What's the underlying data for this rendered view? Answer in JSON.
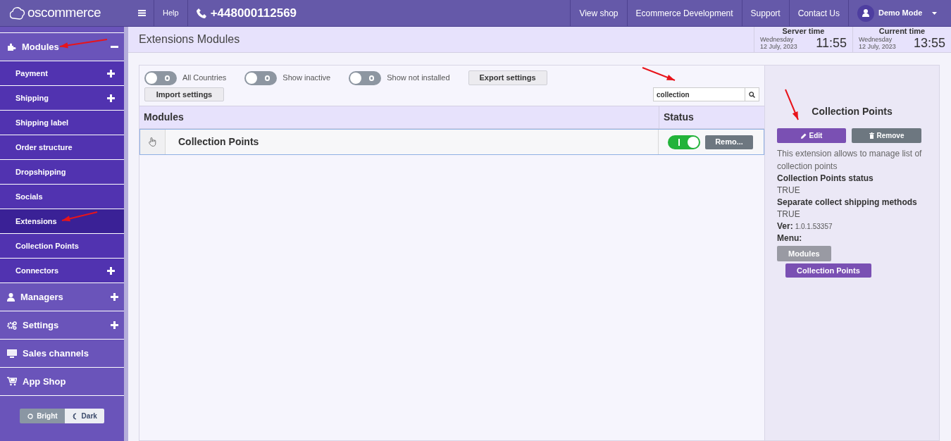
{
  "topbar": {
    "logo": "oscommerce",
    "help": "Help",
    "phone": "+448000112569",
    "links": [
      "View shop",
      "Ecommerce Development",
      "Support",
      "Contact Us"
    ],
    "user": "Demo Mode"
  },
  "sidebar": {
    "items": [
      {
        "label": "Modules",
        "expandable": true,
        "expanded": true,
        "children": [
          {
            "label": "Payment",
            "expandable": true,
            "selected": false
          },
          {
            "label": "Shipping",
            "expandable": true,
            "selected": false
          },
          {
            "label": "Shipping label",
            "expandable": false,
            "selected": false
          },
          {
            "label": "Order structure",
            "expandable": false,
            "selected": false
          },
          {
            "label": "Dropshipping",
            "expandable": false,
            "selected": false
          },
          {
            "label": "Socials",
            "expandable": false,
            "selected": false
          },
          {
            "label": "Extensions",
            "expandable": false,
            "selected": true
          },
          {
            "label": "Collection Points",
            "expandable": false,
            "selected": false
          },
          {
            "label": "Connectors",
            "expandable": true,
            "selected": false
          }
        ]
      },
      {
        "label": "Managers",
        "expandable": true,
        "expanded": false
      },
      {
        "label": "Settings",
        "expandable": true,
        "expanded": false
      },
      {
        "label": "Sales channels",
        "expandable": false
      },
      {
        "label": "App Shop",
        "expandable": false
      }
    ],
    "theme": [
      {
        "label": "Bright",
        "selected": true
      },
      {
        "label": "Dark",
        "selected": false
      }
    ]
  },
  "page": {
    "title": "Extensions Modules",
    "clocks": [
      {
        "label": "Server time",
        "day": "Wednesday",
        "date": "12 July, 2023",
        "time": "11:55"
      },
      {
        "label": "Current time",
        "day": "Wednesday",
        "date": "12 July, 2023",
        "time": "13:55"
      }
    ]
  },
  "filters": [
    {
      "label": "All Countries",
      "on": false
    },
    {
      "label": "Show inactive",
      "on": false
    },
    {
      "label": "Show not installed",
      "on": false
    }
  ],
  "buttons": [
    "Export settings",
    "Import settings"
  ],
  "search": {
    "value": "collection"
  },
  "table": {
    "columns": [
      "Modules",
      "Status"
    ],
    "rows": [
      {
        "name": "Collection Points",
        "on": true,
        "action": "Remo...",
        "selected": true
      }
    ]
  },
  "detail": {
    "title": "Collection Points",
    "edit": "Edit",
    "remove": "Remove",
    "description": "This extension allows to manage list of collection points",
    "fields": [
      {
        "label": "Collection Points status",
        "value": "TRUE"
      },
      {
        "label": "Separate collect shipping methods",
        "value": "TRUE"
      }
    ],
    "version": {
      "label": "Ver:",
      "value": "1.0.1.53357"
    },
    "menu_label": "Menu:",
    "menu": [
      {
        "label": "Modules",
        "children": [
          {
            "label": "Collection Points"
          }
        ]
      }
    ]
  }
}
